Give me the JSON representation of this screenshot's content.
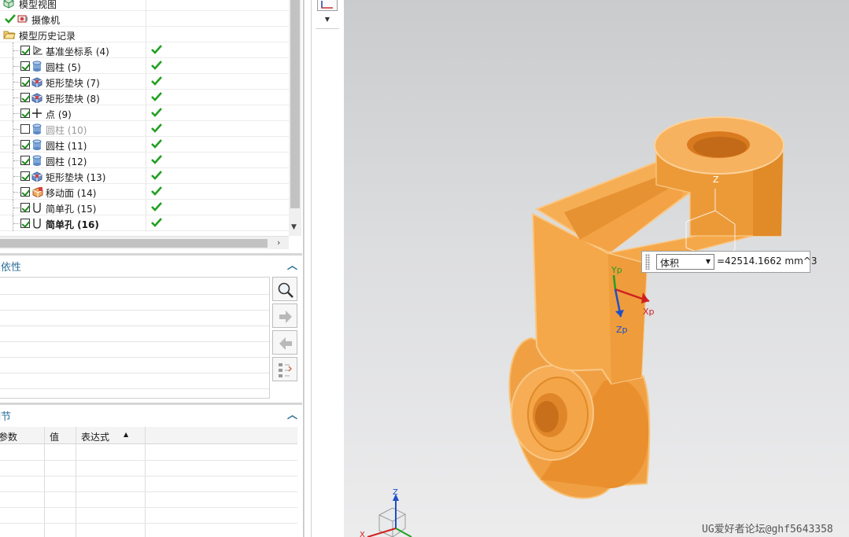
{
  "tree": {
    "rows": [
      {
        "label": "模型视图",
        "icon": "model-views-icon",
        "level": 0
      },
      {
        "label": "摄像机",
        "icon": "camera-icon",
        "level": 1
      },
      {
        "label": "模型历史记录",
        "icon": "folder-open-icon",
        "level": 0
      },
      {
        "label": "基准坐标系 (4)",
        "icon": "datum-csys-icon",
        "checked": true,
        "status": "ok"
      },
      {
        "label": "圆柱 (5)",
        "icon": "cylinder-icon",
        "checked": true,
        "status": "ok"
      },
      {
        "label": "矩形垫块 (7)",
        "icon": "pad-icon",
        "checked": true,
        "status": "ok"
      },
      {
        "label": "矩形垫块 (8)",
        "icon": "pad-icon",
        "checked": true,
        "status": "ok"
      },
      {
        "label": "点 (9)",
        "icon": "point-icon",
        "checked": true,
        "status": "ok"
      },
      {
        "label": "圆柱 (10)",
        "icon": "cylinder-icon",
        "checked": false,
        "status": "ok",
        "dimmed": true
      },
      {
        "label": "圆柱 (11)",
        "icon": "cylinder-icon",
        "checked": true,
        "status": "ok"
      },
      {
        "label": "圆柱 (12)",
        "icon": "cylinder-icon",
        "checked": true,
        "status": "ok"
      },
      {
        "label": "矩形垫块 (13)",
        "icon": "pad-icon",
        "checked": true,
        "status": "ok"
      },
      {
        "label": "移动面 (14)",
        "icon": "move-face-icon",
        "checked": true,
        "status": "ok"
      },
      {
        "label": "简单孔 (15)",
        "icon": "hole-icon",
        "checked": true,
        "status": "ok"
      },
      {
        "label": "简单孔 (16)",
        "icon": "hole-icon",
        "checked": true,
        "status": "ok",
        "bold": true
      }
    ]
  },
  "dependencies": {
    "title": "相依性"
  },
  "details": {
    "title": "细节",
    "columns": [
      "参数",
      "值",
      "表达式"
    ]
  },
  "viewport": {
    "measure_type": "体积",
    "measure_value": "=42514.1662 mm^3",
    "axis_labels": {
      "zc": "Z",
      "xp": "Xp",
      "yp": "Yp",
      "zp": "Zp",
      "triad_x": "X",
      "triad_z": "Z"
    }
  },
  "watermark": "UG爱好者论坛@ghf5643358",
  "colors": {
    "part_fill": "#f5a84a",
    "part_dark": "#e08a28",
    "accent": "#2a6e99",
    "ok_green": "#22a022"
  }
}
